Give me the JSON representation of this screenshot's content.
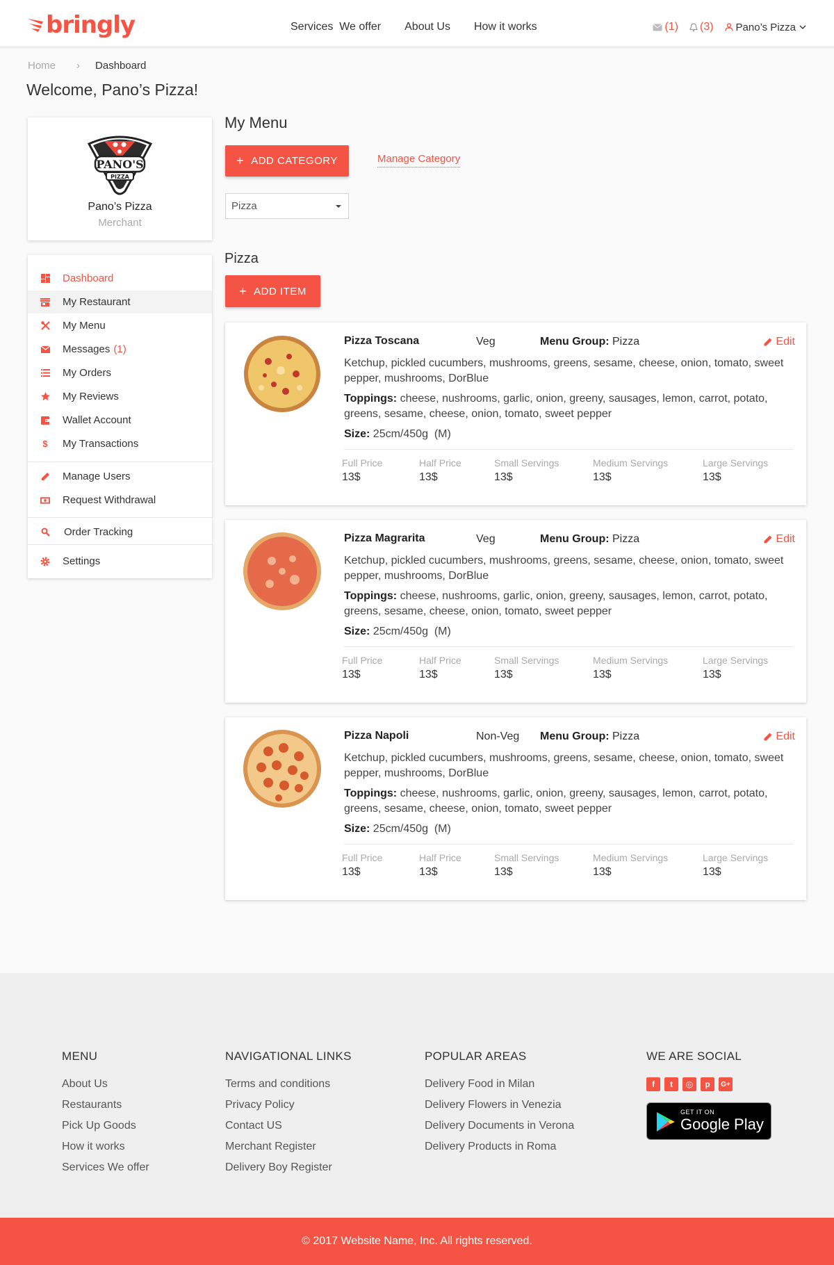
{
  "header": {
    "logo_text": "bringly",
    "nav": [
      "Services  We offer",
      "About Us",
      "How it works"
    ],
    "messages_count": "(1)",
    "notifications_count": "(3)",
    "user_name": "Pano’s Pizza"
  },
  "breadcrumb": {
    "home": "Home",
    "current": "Dashboard"
  },
  "welcome": "Welcome, Pano’s Pizza!",
  "profile": {
    "name": "Pano’s Pizza",
    "role": "Merchant",
    "logo_text": "PANO'S",
    "logo_sub": "PIZZA"
  },
  "sidebar": {
    "items": [
      {
        "label": "Dashboard",
        "icon": "dashboard-icon"
      },
      {
        "label": "My Restaurant",
        "icon": "store-icon"
      },
      {
        "label": "My Menu",
        "icon": "utensils-icon"
      },
      {
        "label": "Messages",
        "badge": "(1)",
        "icon": "mail-icon"
      },
      {
        "label": "My Orders",
        "icon": "list-icon"
      },
      {
        "label": "My Reviews",
        "icon": "star-icon"
      },
      {
        "label": "Wallet Account",
        "icon": "wallet-icon"
      },
      {
        "label": "My Transactions",
        "icon": "dollar-icon"
      },
      {
        "label": "Manage Users",
        "icon": "pencil-icon"
      },
      {
        "label": "Request Withdrawal",
        "icon": "money-icon"
      },
      {
        "label": "Order Tracking",
        "icon": "search-icon"
      },
      {
        "label": "Settings",
        "icon": "gear-icon"
      }
    ]
  },
  "main": {
    "heading": "My Menu",
    "add_category": "ADD CATEGORY",
    "manage_category": "Manage Category",
    "category_select": "Pizza",
    "section_title": "Pizza",
    "add_item": "ADD ITEM",
    "edit_label": "Edit",
    "menu_group_label": "Menu Group:",
    "toppings_label": "Toppings:",
    "size_label": "Size:",
    "price_labels": [
      "Full Price",
      "Half Price",
      "Small Servings",
      "Medium Servings",
      "Large Servings"
    ],
    "items": [
      {
        "name": "Pizza Toscana",
        "type": "Veg",
        "menu_group": "Pizza",
        "description": "Ketchup, pickled cucumbers, mushrooms, greens, sesame, cheese, onion, tomato, sweet pepper, mushrooms, DorBlue",
        "toppings": "cheese, nushrooms, garlic, onion, greeny, sausages, lemon, carrot, potato, greens, sesame, cheese, onion, tomato, sweet pepper",
        "size": "25cm/450g  (M)",
        "prices": [
          "13$",
          "13$",
          "13$",
          "13$",
          "13$"
        ]
      },
      {
        "name": "Pizza Magrarita",
        "type": "Veg",
        "menu_group": "Pizza",
        "description": "Ketchup, pickled cucumbers, mushrooms, greens, sesame, cheese, onion, tomato, sweet pepper, mushrooms, DorBlue",
        "toppings": "cheese, nushrooms, garlic, onion, greeny, sausages, lemon, carrot, potato, greens, sesame, cheese, onion, tomato, sweet pepper",
        "size": "25cm/450g  (M)",
        "prices": [
          "13$",
          "13$",
          "13$",
          "13$",
          "13$"
        ]
      },
      {
        "name": "Pizza Napoli",
        "type": "Non-Veg",
        "menu_group": "Pizza",
        "description": "Ketchup, pickled cucumbers, mushrooms, greens, sesame, cheese, onion, tomato, sweet pepper, mushrooms, DorBlue",
        "toppings": "cheese, nushrooms, garlic, onion, greeny, sausages, lemon, carrot, potato, greens, sesame, cheese, onion, tomato, sweet pepper",
        "size": "25cm/450g  (M)",
        "prices": [
          "13$",
          "13$",
          "13$",
          "13$",
          "13$"
        ]
      }
    ]
  },
  "footer": {
    "menu": {
      "title": "MENU",
      "links": [
        "About Us",
        "Restaurants",
        "Pick Up Goods",
        "How it works",
        "Services We offer"
      ]
    },
    "nav_links": {
      "title": "NAVIGATIONAL LINKS",
      "links": [
        "Terms and conditions",
        "Privacy Policy",
        "Contact US",
        "Merchant Register",
        "Delivery Boy Register"
      ]
    },
    "areas": {
      "title": "POPULAR AREAS",
      "links": [
        "Delivery Food in Milan",
        "Delivery Flowers in Venezia",
        "Delivery Documents in Verona",
        "Delivery Products in Roma"
      ]
    },
    "social": {
      "title": "WE ARE SOCIAL",
      "icons": [
        "facebook-icon",
        "twitter-icon",
        "instagram-icon",
        "pinterest-icon",
        "google-plus-icon"
      ],
      "icon_glyphs": [
        "f",
        "t",
        "◎",
        "p",
        "G+"
      ]
    },
    "google_play": {
      "top": "GET IT ON",
      "name": "Google Play"
    },
    "copyright": "© 2017 Website Name, Inc. All rights reserved."
  },
  "colors": {
    "accent": "#f55444",
    "background": "#fafafa",
    "footer_bg": "#efefef"
  }
}
